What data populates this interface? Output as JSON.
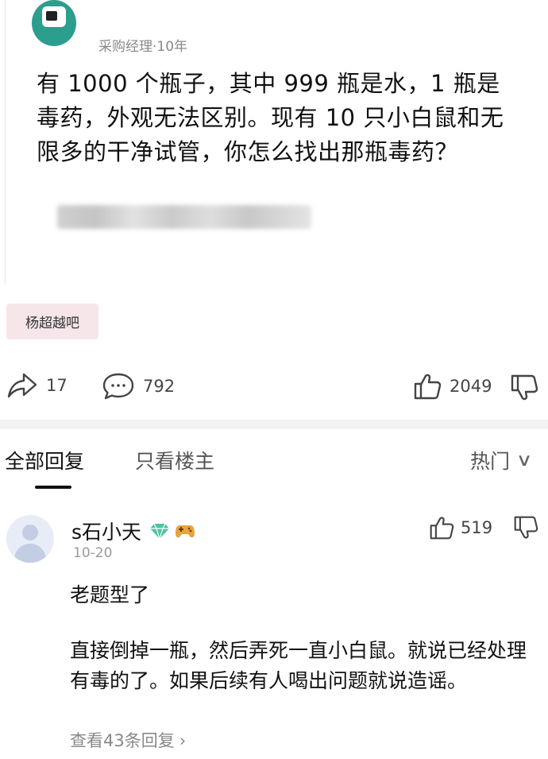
{
  "post": {
    "author_meta": "采购经理·10年",
    "text": "有 1000 个瓶子，其中 999 瓶是水，1 瓶是毒药，外观无法区别。现有 10 只小白鼠和无限多的干净试管，你怎么找出那瓶毒药？",
    "tag": "杨超越吧"
  },
  "actions": {
    "share_count": "17",
    "comment_count": "792",
    "like_count": "2049"
  },
  "tabs": {
    "all_replies": "全部回复",
    "op_only": "只看楼主",
    "sort_label": "热门"
  },
  "comment": {
    "username": "s石小天",
    "date": "10-20",
    "like_count": "519",
    "line1": "老题型了",
    "paragraph2": "直接倒掉一瓶，然后弄死一直小白鼠。就说已经处理有毒的了。如果后续有人喝出问题就说造谣。",
    "view_replies": "查看43条回复"
  },
  "icons": {
    "share": "share-arrow-icon",
    "comment": "comment-bubble-icon",
    "like": "thumbs-up-icon",
    "dislike": "thumbs-down-icon",
    "gem": "diamond-badge-icon",
    "face": "game-controller-badge-icon",
    "chevron": "chevron-down-icon",
    "arrow": "chevron-right-icon"
  },
  "colors": {
    "tag_bg": "#f6e6ea",
    "gem": "#4fc3a1",
    "face": "#e8a33c"
  }
}
